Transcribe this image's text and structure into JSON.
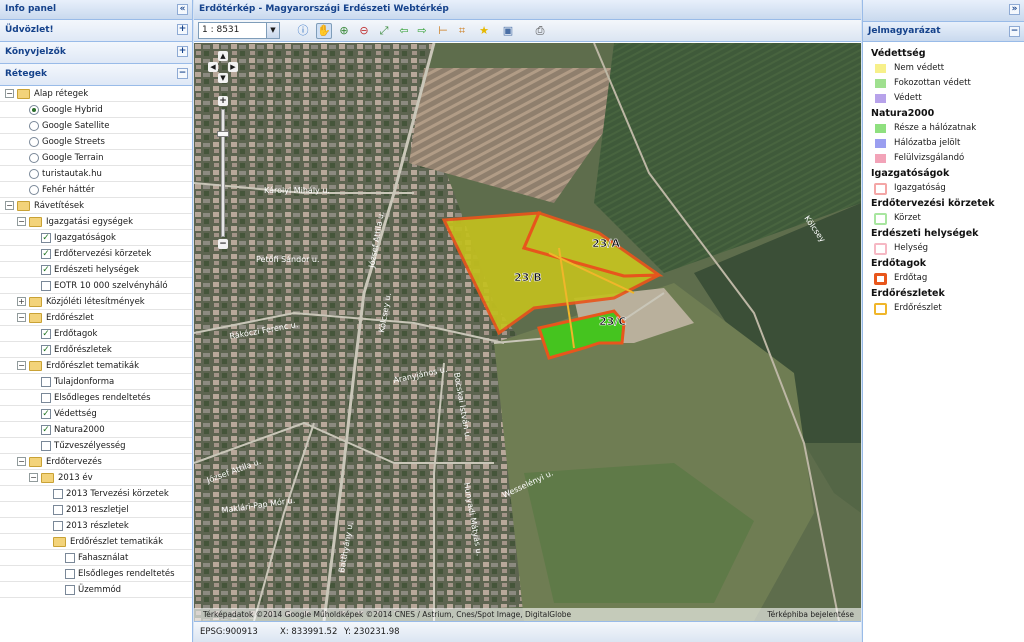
{
  "left": {
    "title": "Info panel",
    "sections": {
      "welcome": "Üdvözlet!",
      "bookmarks": "Könyvjelzők",
      "layers": "Rétegek"
    },
    "tree": [
      {
        "label": "Alap rétegek",
        "type": "folder",
        "toggle": "−"
      },
      {
        "label": "Google Hybrid",
        "type": "radio",
        "checked": true
      },
      {
        "label": "Google Satellite",
        "type": "radio"
      },
      {
        "label": "Google Streets",
        "type": "radio"
      },
      {
        "label": "Google Terrain",
        "type": "radio"
      },
      {
        "label": "turistautak.hu",
        "type": "radio"
      },
      {
        "label": "Fehér háttér",
        "type": "radio"
      },
      {
        "label": "Rávetítések",
        "type": "folder",
        "toggle": "−"
      },
      {
        "label": "Igazgatási egységek",
        "type": "folder",
        "toggle": "−"
      },
      {
        "label": "Igazgatóságok",
        "type": "check",
        "checked": true
      },
      {
        "label": "Erdőtervezési körzetek",
        "type": "check",
        "checked": true
      },
      {
        "label": "Erdészeti helységek",
        "type": "check",
        "checked": true
      },
      {
        "label": "EOTR 10 000 szelvényháló",
        "type": "check"
      },
      {
        "label": "Közjóléti létesítmények",
        "type": "folder",
        "toggle": "+"
      },
      {
        "label": "Erdőrészlet",
        "type": "folder",
        "toggle": "−"
      },
      {
        "label": "Erdőtagok",
        "type": "check",
        "checked": true
      },
      {
        "label": "Erdőrészletek",
        "type": "check",
        "checked": true
      },
      {
        "label": "Erdőrészlet tematikák",
        "type": "folder",
        "toggle": "−"
      },
      {
        "label": "Tulajdonforma",
        "type": "check"
      },
      {
        "label": "Elsődleges rendeltetés",
        "type": "check"
      },
      {
        "label": "Védettség",
        "type": "check",
        "checked": true
      },
      {
        "label": "Natura2000",
        "type": "check",
        "checked": true
      },
      {
        "label": "Tűzveszélyesség",
        "type": "check"
      },
      {
        "label": "Erdőtervezés",
        "type": "folder",
        "toggle": "−"
      },
      {
        "label": "2013 év",
        "type": "folder",
        "toggle": "−"
      },
      {
        "label": "2013 Tervezési körzetek",
        "type": "check"
      },
      {
        "label": "2013 reszletjel",
        "type": "check"
      },
      {
        "label": "2013 részletek",
        "type": "check"
      },
      {
        "label": "Erdőrészlet tematikák",
        "type": "folder"
      },
      {
        "label": "Fahasználat",
        "type": "check"
      },
      {
        "label": "Elsődleges rendeltetés",
        "type": "check"
      },
      {
        "label": "Üzemmód",
        "type": "check"
      }
    ]
  },
  "center": {
    "title": "Erdőtérkép - Magyarországi Erdészeti Webtérkép",
    "scale": "1 : 8531",
    "map_labels": {
      "parcel_a": "23/A",
      "parcel_b": "23/B",
      "parcel_c": "23/C",
      "streets": [
        "Károlyi Mihály u.",
        "Petőfi Sándor u.",
        "Rákóczi Ferenc u.",
        "József Attila u.",
        "Aranyjános u.",
        "József Attila u.",
        "Maklári-Pap Mór u.",
        "Batthyány u.",
        "Kölcsey",
        "Wesselényi u.",
        "Hunyadi Mátyás u.",
        "Bocskai István u.",
        "Kölcsey u."
      ]
    },
    "attribution": "Térképadatok ©2014 Google Műholdképek ©2014 CNES / Astrium, Cnes/Spot Image, DigitalGlobe",
    "report_link": "Térképhiba bejelentése",
    "status": {
      "epsg": "EPSG:900913",
      "x": "X: 833991.52",
      "y": "Y: 230231.98"
    }
  },
  "right": {
    "title": "Jelmagyarázat",
    "groups": [
      {
        "title": "Védettség",
        "items": [
          {
            "label": "Nem védett",
            "color": "#f7f08a"
          },
          {
            "label": "Fokozottan védett",
            "color": "#9fe08f"
          },
          {
            "label": "Védett",
            "color": "#b7a2ea"
          }
        ]
      },
      {
        "title": "Natura2000",
        "items": [
          {
            "label": "Része a hálózatnak",
            "color": "#8fe07f"
          },
          {
            "label": "Hálózatba jelölt",
            "color": "#9a9ef0"
          },
          {
            "label": "Felülvizsgálandó",
            "color": "#f2a3b8"
          }
        ]
      },
      {
        "title": "Igazgatóságok",
        "items": [
          {
            "label": "Igazgatóság",
            "color": "#f4a6a6"
          }
        ]
      },
      {
        "title": "Erdőtervezési körzetek",
        "items": [
          {
            "label": "Körzet",
            "color": "#a8e6a0"
          }
        ]
      },
      {
        "title": "Erdészeti helységek",
        "items": [
          {
            "label": "Helység",
            "color": "#f6b8c4"
          }
        ]
      },
      {
        "title": "Erdőtagok",
        "items": [
          {
            "label": "Erdőtag",
            "color": "#e8561c"
          }
        ]
      },
      {
        "title": "Erdőrészletek",
        "items": [
          {
            "label": "Erdőrészlet",
            "color": "#f0b62a"
          }
        ]
      }
    ]
  }
}
